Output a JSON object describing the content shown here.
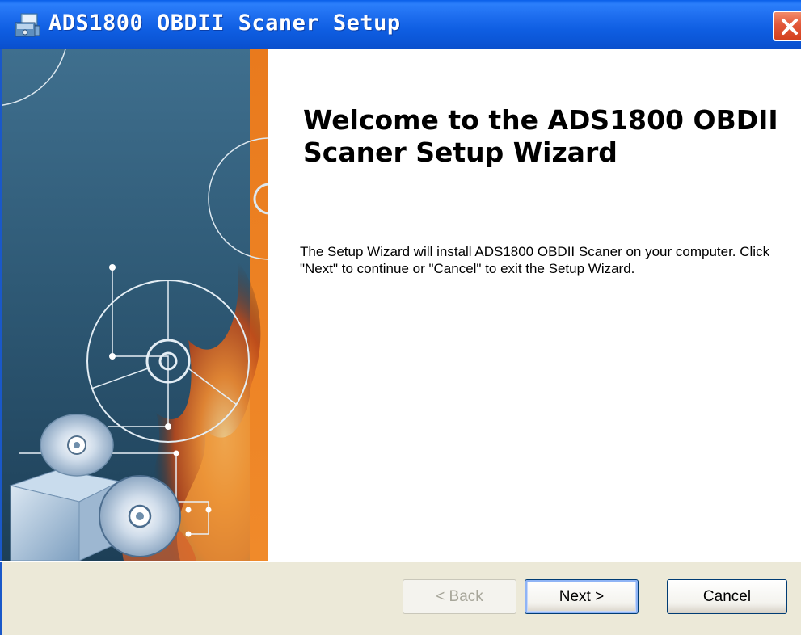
{
  "window": {
    "title": "ADS1800 OBDII Scaner Setup"
  },
  "content": {
    "heading": "Welcome to the ADS1800 OBDII Scaner Setup Wizard",
    "description": "The Setup Wizard will install ADS1800 OBDII Scaner on your computer.  Click \"Next\" to continue or \"Cancel\" to exit the Setup Wizard."
  },
  "buttons": {
    "back": "< Back",
    "next": "Next >",
    "cancel": "Cancel"
  },
  "icons": {
    "app": "installer-icon",
    "close": "close-icon"
  },
  "colors": {
    "titlebar": "#0f5ee2",
    "close": "#d4411f",
    "panel": "#ffffff",
    "chrome": "#ece9d8"
  }
}
